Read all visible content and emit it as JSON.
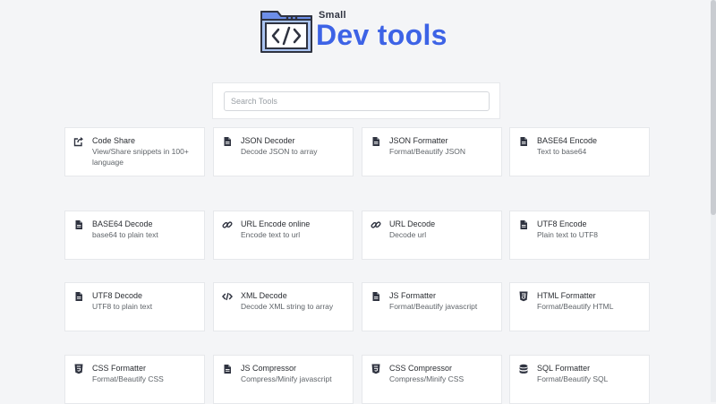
{
  "logo": {
    "small": "Small",
    "main": "Dev tools"
  },
  "search": {
    "placeholder": "Search Tools",
    "value": ""
  },
  "tools": [
    {
      "icon": "share-icon",
      "title": "Code Share",
      "desc": "View/Share snippets in 100+ language"
    },
    {
      "icon": "file-icon",
      "title": "JSON Decoder",
      "desc": "Decode JSON to array"
    },
    {
      "icon": "file-icon",
      "title": "JSON Formatter",
      "desc": "Format/Beautify JSON"
    },
    {
      "icon": "file-icon",
      "title": "BASE64 Encode",
      "desc": "Text to base64"
    },
    {
      "icon": "file-icon",
      "title": "BASE64 Decode",
      "desc": "base64 to plain text"
    },
    {
      "icon": "link-icon",
      "title": "URL Encode online",
      "desc": "Encode text to url"
    },
    {
      "icon": "link-icon",
      "title": "URL Decode",
      "desc": "Decode url"
    },
    {
      "icon": "file-icon",
      "title": "UTF8 Encode",
      "desc": "Plain text to UTF8"
    },
    {
      "icon": "file-icon",
      "title": "UTF8 Decode",
      "desc": "UTF8 to plain text"
    },
    {
      "icon": "code-icon",
      "title": "XML Decode",
      "desc": "Decode XML string to array"
    },
    {
      "icon": "file-icon",
      "title": "JS Formatter",
      "desc": "Format/Beautify javascript"
    },
    {
      "icon": "html5-icon",
      "title": "HTML Formatter",
      "desc": "Format/Beautify HTML"
    },
    {
      "icon": "css3-icon",
      "title": "CSS Formatter",
      "desc": "Format/Beautify CSS"
    },
    {
      "icon": "file-icon",
      "title": "JS Compressor",
      "desc": "Compress/Minify javascript"
    },
    {
      "icon": "css3-icon",
      "title": "CSS Compressor",
      "desc": "Compress/Minify CSS"
    },
    {
      "icon": "database-icon",
      "title": "SQL Formatter",
      "desc": "Format/Beautify SQL"
    }
  ]
}
